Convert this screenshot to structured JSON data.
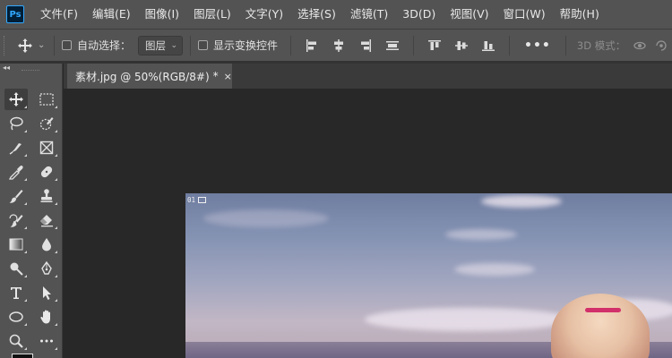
{
  "app": {
    "logo_text": "Ps"
  },
  "menu": [
    "文件(F)",
    "编辑(E)",
    "图像(I)",
    "图层(L)",
    "文字(Y)",
    "选择(S)",
    "滤镜(T)",
    "3D(D)",
    "视图(V)",
    "窗口(W)",
    "帮助(H)"
  ],
  "options": {
    "auto_select_label": "自动选择：",
    "auto_select_checked": false,
    "layer_select_value": "图层",
    "show_transform_label": "显示变换控件",
    "show_transform_checked": false,
    "more_label": "•••",
    "mode_3d_label": "3D 模式："
  },
  "document_tab": {
    "title": "素材.jpg @ 50%(RGB/8#)",
    "modified_mark": "*",
    "close_label": "×"
  },
  "canvas": {
    "badge_text": "01"
  },
  "toolbar": {
    "collapse_label": "◂◂",
    "tools": [
      "move-tool",
      "rectangular-marquee-tool",
      "lasso-tool",
      "quick-selection-tool",
      "pen-path-tool",
      "frame-tool",
      "eyedropper-tool",
      "healing-brush-tool",
      "brush-tool",
      "clone-stamp-tool",
      "history-brush-tool",
      "eraser-tool",
      "gradient-tool",
      "blur-tool",
      "dodge-tool",
      "pen-tool",
      "type-tool",
      "path-selection-tool",
      "ellipse-tool",
      "hand-tool",
      "zoom-tool",
      "more-tools"
    ]
  },
  "colors": {
    "ps_logo_bg": "#001e36",
    "ps_logo_fg": "#31a8ff",
    "ui_panel": "#535353",
    "workspace": "#282828",
    "hairclip": "#d2306a"
  }
}
